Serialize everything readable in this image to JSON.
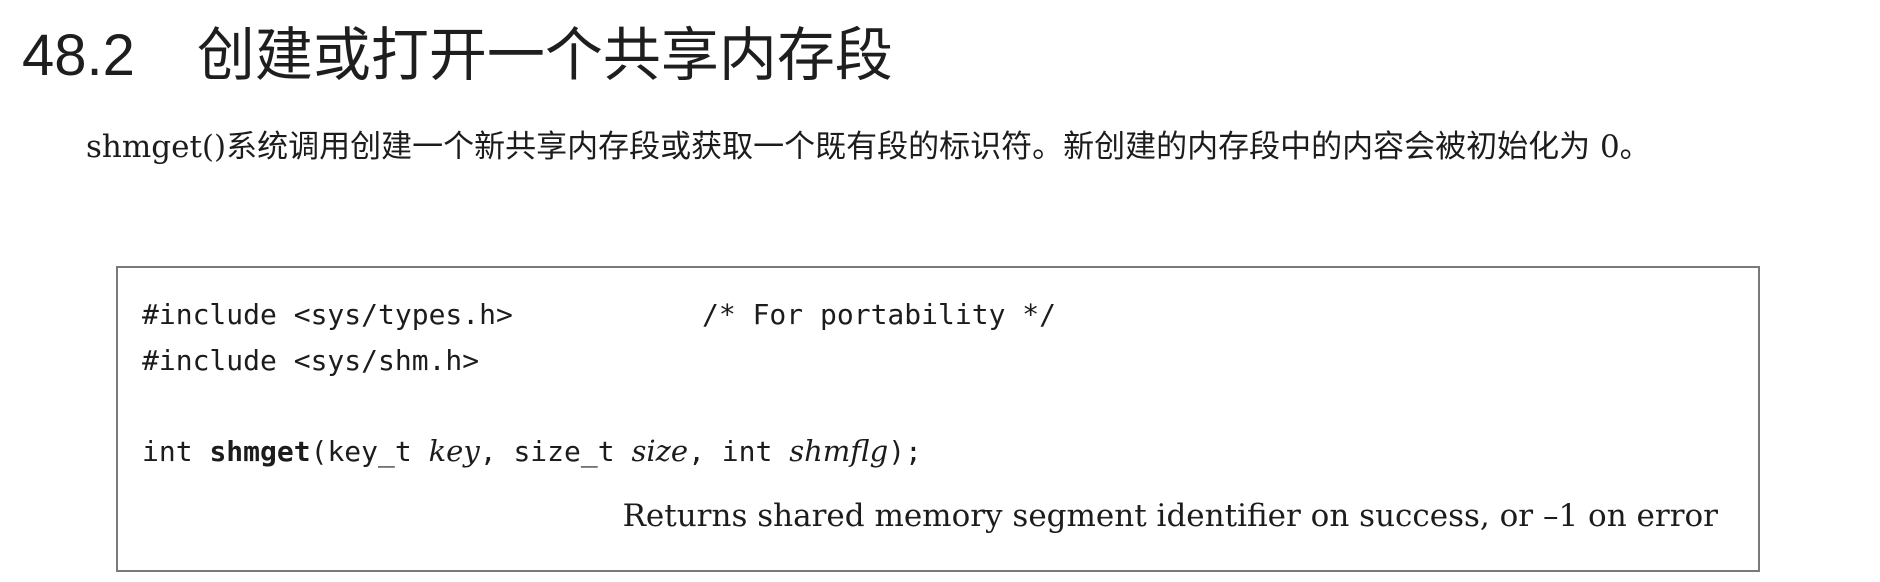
{
  "section": {
    "number": "48.2",
    "title": "创建或打开一个共享内存段"
  },
  "paragraph": "shmget()系统调用创建一个新共享内存段或获取一个既有段的标识符。新创建的内存段中的内容会被初始化为 0。",
  "code": {
    "line1": "#include <sys/types.h>",
    "line1_comment": "/* For portability */",
    "line2": "#include <sys/shm.h>",
    "sig_return": "int ",
    "sig_name": "shmget",
    "sig_open": "(key_t ",
    "param1": "key",
    "sep1": ", size_t ",
    "param2": "size",
    "sep2": ", int ",
    "param3": "shmflg",
    "sig_close": ");",
    "returns": "Returns shared memory segment identifier on success, or –1 on error"
  }
}
